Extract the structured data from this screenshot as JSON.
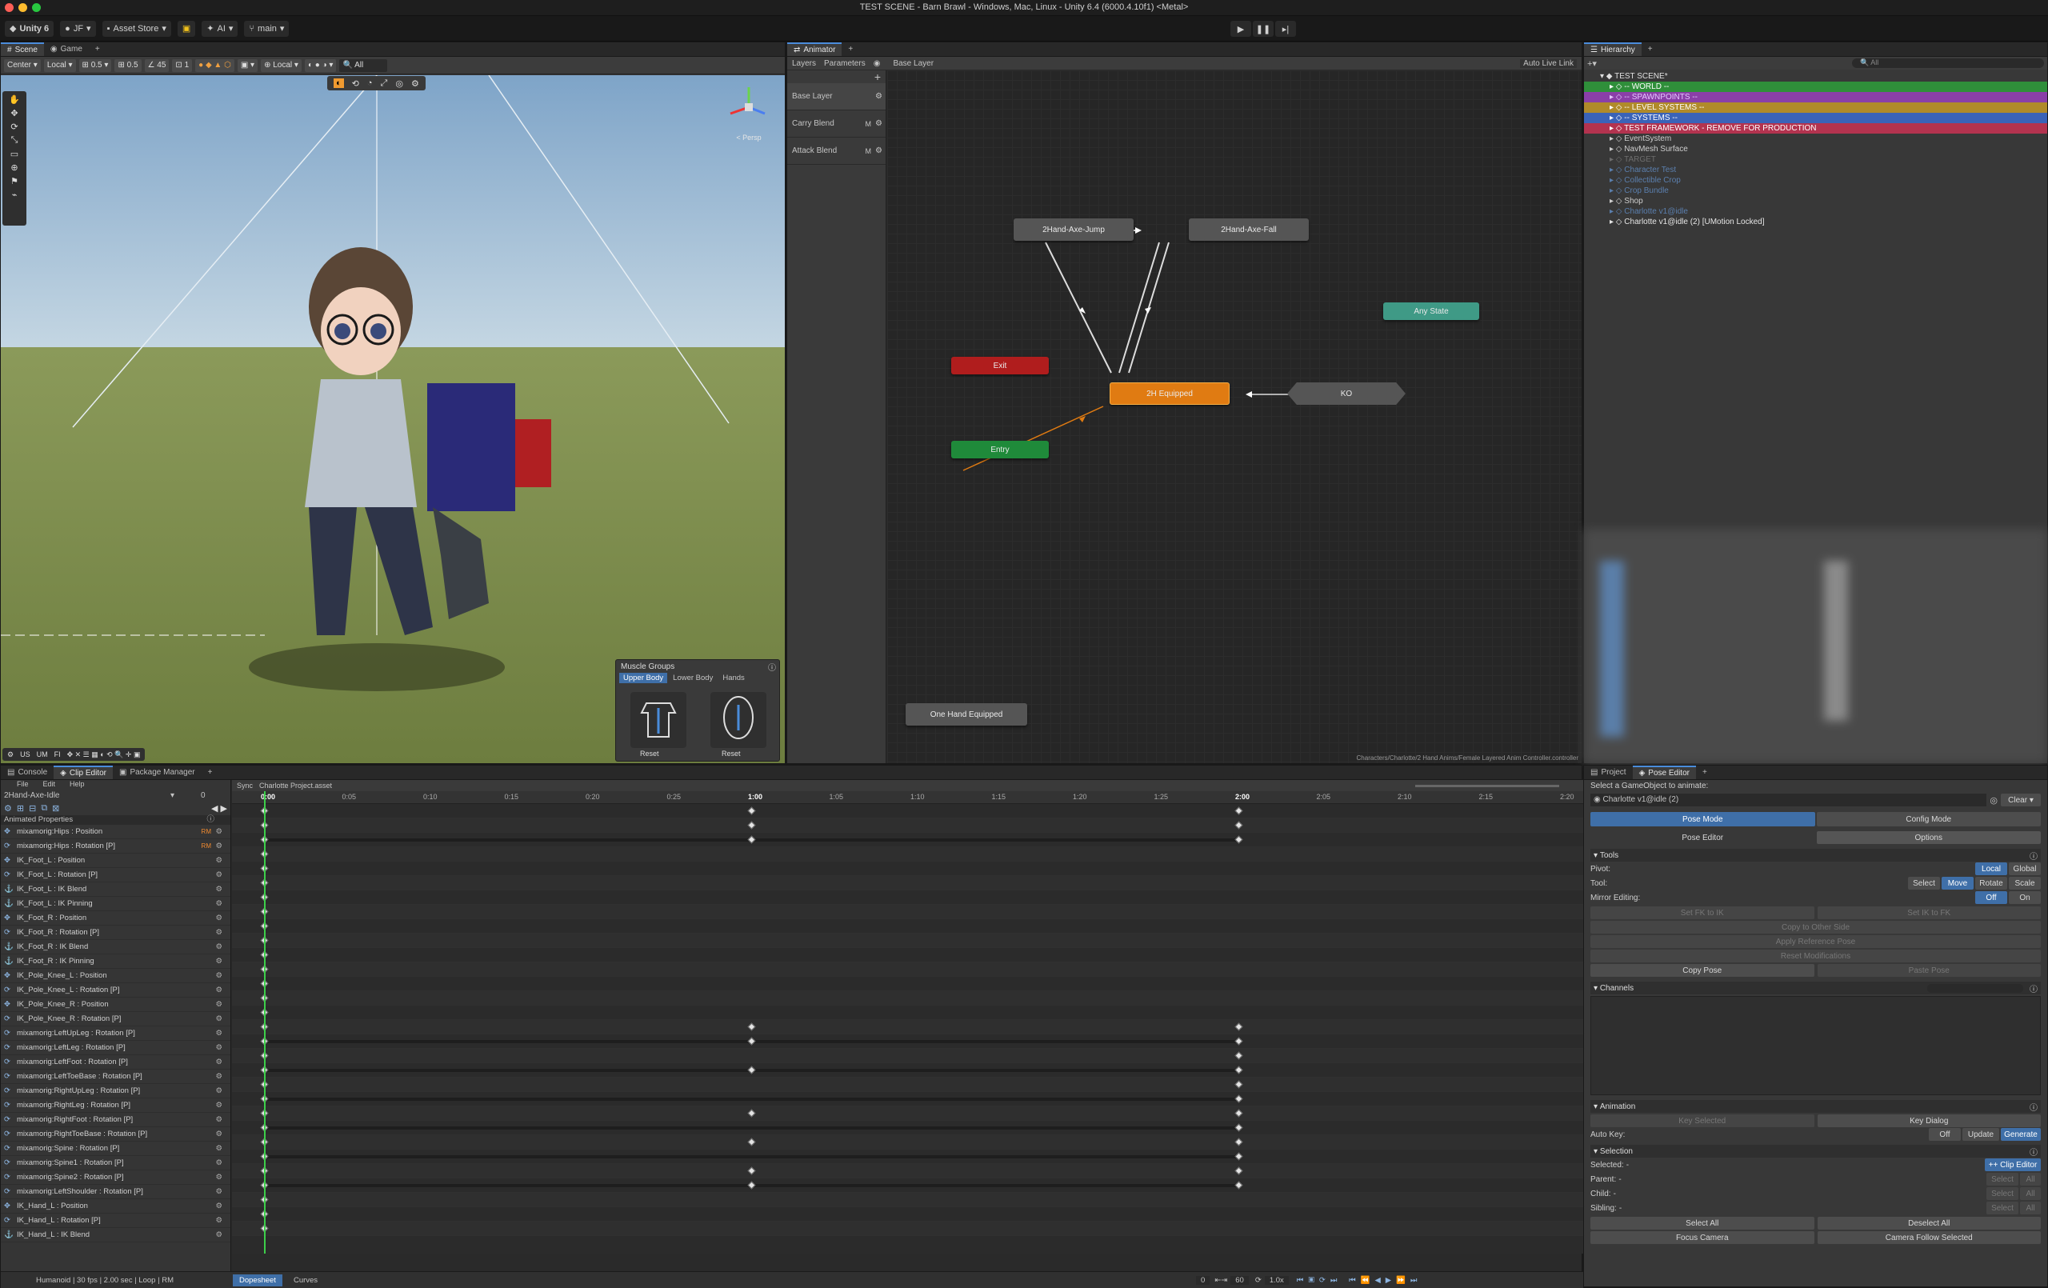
{
  "window": {
    "title": "TEST SCENE - Barn Brawl - Windows, Mac, Linux - Unity 6.4 (6000.4.10f1) <Metal>"
  },
  "topbar": {
    "unity": "Unity 6",
    "account": "JF",
    "asset_store": "Asset Store",
    "ai": "AI",
    "branch": "main"
  },
  "scene": {
    "tabs": [
      "Scene",
      "Game"
    ],
    "tools": {
      "pivot": "Center",
      "space": "Local",
      "snap1": "0.5",
      "snap2": "0.5",
      "angle": "45",
      "count": "1",
      "local2": "Local"
    },
    "gizmo_label": "< Persp",
    "bottom_tools": [
      "US",
      "UM",
      "FI"
    ]
  },
  "muscle": {
    "title": "Muscle Groups",
    "tabs": [
      "Upper Body",
      "Lower Body",
      "Hands"
    ],
    "reset1": "Reset",
    "reset2": "Reset"
  },
  "animator": {
    "tab": "Animator",
    "layers_tab": "Layers",
    "params_tab": "Parameters",
    "breadcrumb": "Base Layer",
    "live_link": "Auto Live Link",
    "layers": [
      {
        "name": "Base Layer"
      },
      {
        "name": "Carry Blend",
        "badge": "M"
      },
      {
        "name": "Attack Blend",
        "badge": "M"
      }
    ],
    "nodes": {
      "jump": "2Hand-Axe-Jump",
      "fall": "2Hand-Axe-Fall",
      "any": "Any State",
      "exit": "Exit",
      "equipped": "2H Equipped",
      "ko": "KO",
      "entry": "Entry",
      "one_hand": "One Hand Equipped"
    },
    "path": "Characters/Charlotte/2 Hand Anims/Female Layered Anim Controller.controller"
  },
  "hierarchy": {
    "tab": "Hierarchy",
    "search": "All",
    "items": [
      {
        "label": "TEST SCENE*",
        "indent": 0,
        "color": "",
        "text": "#e0e0e0"
      },
      {
        "label": "-- WORLD --",
        "indent": 1,
        "color": "#2f8f3a",
        "text": "#fff"
      },
      {
        "label": "-- SPAWNPOINTS --",
        "indent": 1,
        "color": "#8a3fa8",
        "text": "#e6c6ff"
      },
      {
        "label": "-- LEVEL SYSTEMS --",
        "indent": 1,
        "color": "#b08a2a",
        "text": "#fff"
      },
      {
        "label": "-- SYSTEMS --",
        "indent": 1,
        "color": "#3a63b8",
        "text": "#fff"
      },
      {
        "label": "TEST FRAMEWORK - REMOVE FOR PRODUCTION",
        "indent": 1,
        "color": "#b3334f",
        "text": "#fff"
      },
      {
        "label": "EventSystem",
        "indent": 1,
        "color": "",
        "text": "#cfcfcf"
      },
      {
        "label": "NavMesh Surface",
        "indent": 1,
        "color": "",
        "text": "#cfcfcf"
      },
      {
        "label": "TARGET",
        "indent": 1,
        "color": "",
        "text": "#6e6e6e"
      },
      {
        "label": "Character Test",
        "indent": 1,
        "color": "",
        "text": "#5b7fae"
      },
      {
        "label": "Collectible Crop",
        "indent": 1,
        "color": "",
        "text": "#5b7fae"
      },
      {
        "label": "Crop Bundle",
        "indent": 1,
        "color": "",
        "text": "#5b7fae"
      },
      {
        "label": "Shop",
        "indent": 1,
        "color": "",
        "text": "#cfcfcf"
      },
      {
        "label": "Charlotte v1@idle",
        "indent": 1,
        "color": "",
        "text": "#5b7fae"
      },
      {
        "label": "Charlotte v1@idle (2) [UMotion Locked]",
        "indent": 1,
        "color": "",
        "text": "#e6e6e6"
      }
    ]
  },
  "bottom_tabs": [
    "Console",
    "Clip Editor",
    "Package Manager"
  ],
  "clip": {
    "menu": [
      "File",
      "Edit",
      "Help"
    ],
    "clip_name": "2Hand-Axe-Idle",
    "frame": "0",
    "sync": "Sync",
    "project": "Charlotte Project.asset",
    "section": "Animated Properties",
    "ruler": [
      "0:00",
      "0:05",
      "0:10",
      "0:15",
      "0:20",
      "0:25",
      "1:00",
      "1:05",
      "1:10",
      "1:15",
      "1:20",
      "1:25",
      "2:00",
      "2:05",
      "2:10",
      "2:15",
      "2:20"
    ],
    "props": [
      "mixamorig:Hips : Position",
      "mixamorig:Hips : Rotation [P]",
      "IK_Foot_L : Position",
      "IK_Foot_L : Rotation [P]",
      "IK_Foot_L : IK Blend",
      "IK_Foot_L : IK Pinning",
      "IK_Foot_R : Position",
      "IK_Foot_R : Rotation [P]",
      "IK_Foot_R : IK Blend",
      "IK_Foot_R : IK Pinning",
      "IK_Pole_Knee_L : Position",
      "IK_Pole_Knee_L : Rotation [P]",
      "IK_Pole_Knee_R : Position",
      "IK_Pole_Knee_R : Rotation [P]",
      "mixamorig:LeftUpLeg : Rotation [P]",
      "mixamorig:LeftLeg : Rotation [P]",
      "mixamorig:LeftFoot : Rotation [P]",
      "mixamorig:LeftToeBase : Rotation [P]",
      "mixamorig:RightUpLeg : Rotation [P]",
      "mixamorig:RightLeg : Rotation [P]",
      "mixamorig:RightFoot : Rotation [P]",
      "mixamorig:RightToeBase : Rotation [P]",
      "mixamorig:Spine : Rotation [P]",
      "mixamorig:Spine1 : Rotation [P]",
      "mixamorig:Spine2 : Rotation [P]",
      "mixamorig:LeftShoulder : Rotation [P]",
      "IK_Hand_L : Position",
      "IK_Hand_L : Rotation [P]",
      "IK_Hand_L : IK Blend"
    ],
    "rm": "RM",
    "status": "Humanoid | 30 fps | 2.00 sec | Loop | RM",
    "view_tabs": [
      "Dopesheet",
      "Curves"
    ],
    "start": "0",
    "end": "60",
    "speed": "1.0x"
  },
  "pose": {
    "tabs": [
      "Project",
      "Pose Editor"
    ],
    "select_label": "Select a GameObject to animate:",
    "object": "Charlotte v1@idle (2)",
    "clear": "Clear",
    "mode_pose": "Pose Mode",
    "mode_config": "Config Mode",
    "sub_pose": "Pose Editor",
    "sub_options": "Options",
    "tools": "Tools",
    "pivot_label": "Pivot:",
    "pivot_local": "Local",
    "pivot_global": "Global",
    "tool_label": "Tool:",
    "tool_select": "Select",
    "tool_move": "Move",
    "tool_rotate": "Rotate",
    "tool_scale": "Scale",
    "mirror_label": "Mirror Editing:",
    "off": "Off",
    "on": "On",
    "set_fk": "Set FK to IK",
    "set_ik": "Set IK to FK",
    "copy_side": "Copy to Other Side",
    "apply_ref": "Apply Reference Pose",
    "reset_mod": "Reset Modifications",
    "copy_pose": "Copy Pose",
    "paste_pose": "Paste Pose",
    "channels": "Channels",
    "animation": "Animation",
    "key_selected": "Key Selected",
    "key_dialog": "Key Dialog",
    "auto_key": "Auto Key:",
    "ak_off": "Off",
    "ak_update": "Update",
    "ak_generate": "Generate",
    "selection": "Selection",
    "sel_selected": "Selected:",
    "sel_parent": "Parent:",
    "sel_child": "Child:",
    "sel_sibling": "Sibling:",
    "dash": "-",
    "clip_editor_btn": "++ Clip Editor",
    "select": "Select",
    "all": "All",
    "select_all": "Select All",
    "deselect_all": "Deselect All",
    "focus_camera": "Focus Camera",
    "camera_follow": "Camera Follow Selected"
  },
  "colors": {
    "entry": "#1f8a3a",
    "exit": "#b01d1d",
    "any": "#3f9a86",
    "equipped": "#e07b12",
    "state": "#555555",
    "accent": "#4a8cdb"
  }
}
